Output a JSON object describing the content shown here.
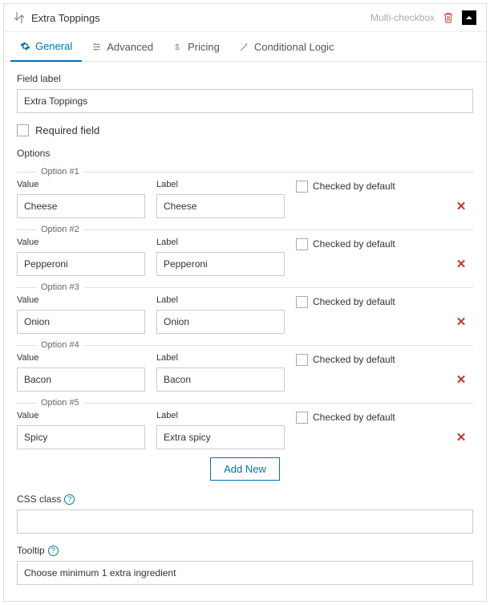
{
  "header": {
    "title": "Extra Toppings",
    "field_type": "Multi-checkbox"
  },
  "tabs": {
    "general": "General",
    "advanced": "Advanced",
    "pricing": "Pricing",
    "conditional": "Conditional Logic"
  },
  "labels": {
    "field_label": "Field label",
    "required": "Required field",
    "options": "Options",
    "value": "Value",
    "label": "Label",
    "checked": "Checked by default",
    "css_class": "CSS class",
    "tooltip": "Tooltip",
    "add_new": "Add New"
  },
  "values": {
    "field_label": "Extra Toppings",
    "css_class": "",
    "tooltip": "Choose minimum 1 extra ingredient"
  },
  "options": [
    {
      "legend": "Option #1",
      "value": "Cheese",
      "label": "Cheese"
    },
    {
      "legend": "Option #2",
      "value": "Pepperoni",
      "label": "Pepperoni"
    },
    {
      "legend": "Option #3",
      "value": "Onion",
      "label": "Onion"
    },
    {
      "legend": "Option #4",
      "value": "Bacon",
      "label": "Bacon"
    },
    {
      "legend": "Option #5",
      "value": "Spicy",
      "label": "Extra spicy"
    }
  ]
}
